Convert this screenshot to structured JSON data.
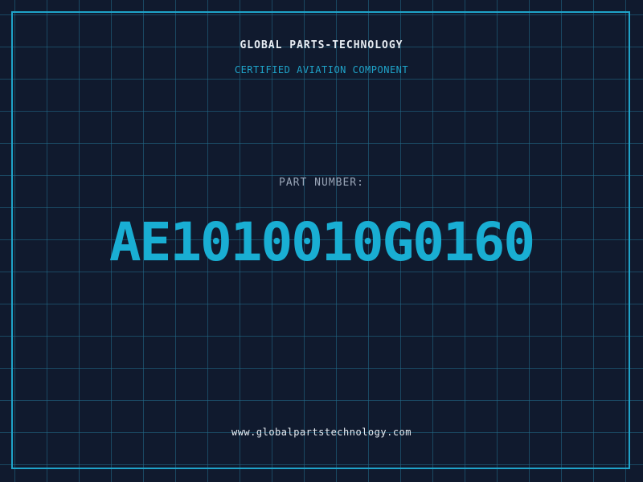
{
  "header": {
    "company": "GLOBAL PARTS-TECHNOLOGY",
    "subtitle": "CERTIFIED AVIATION COMPONENT"
  },
  "part": {
    "label": "PART NUMBER:",
    "number": "AE1010010G0160"
  },
  "footer": {
    "website": "www.globalpartstechnology.com"
  },
  "colors": {
    "background": "#101a2e",
    "accent": "#19aed3",
    "text": "#e8edf3",
    "muted": "#9aa6b8"
  }
}
